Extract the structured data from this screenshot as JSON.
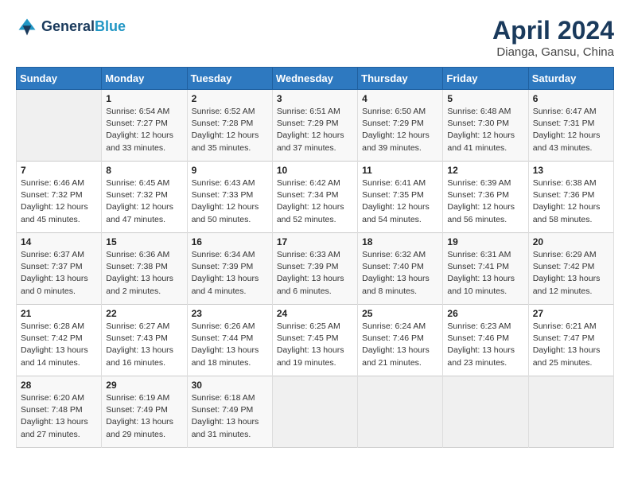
{
  "header": {
    "logo_line1": "General",
    "logo_line2": "Blue",
    "month": "April 2024",
    "location": "Dianga, Gansu, China"
  },
  "weekdays": [
    "Sunday",
    "Monday",
    "Tuesday",
    "Wednesday",
    "Thursday",
    "Friday",
    "Saturday"
  ],
  "weeks": [
    [
      {
        "day": null,
        "info": null
      },
      {
        "day": "1",
        "info": "Sunrise: 6:54 AM\nSunset: 7:27 PM\nDaylight: 12 hours\nand 33 minutes."
      },
      {
        "day": "2",
        "info": "Sunrise: 6:52 AM\nSunset: 7:28 PM\nDaylight: 12 hours\nand 35 minutes."
      },
      {
        "day": "3",
        "info": "Sunrise: 6:51 AM\nSunset: 7:29 PM\nDaylight: 12 hours\nand 37 minutes."
      },
      {
        "day": "4",
        "info": "Sunrise: 6:50 AM\nSunset: 7:29 PM\nDaylight: 12 hours\nand 39 minutes."
      },
      {
        "day": "5",
        "info": "Sunrise: 6:48 AM\nSunset: 7:30 PM\nDaylight: 12 hours\nand 41 minutes."
      },
      {
        "day": "6",
        "info": "Sunrise: 6:47 AM\nSunset: 7:31 PM\nDaylight: 12 hours\nand 43 minutes."
      }
    ],
    [
      {
        "day": "7",
        "info": "Sunrise: 6:46 AM\nSunset: 7:32 PM\nDaylight: 12 hours\nand 45 minutes."
      },
      {
        "day": "8",
        "info": "Sunrise: 6:45 AM\nSunset: 7:32 PM\nDaylight: 12 hours\nand 47 minutes."
      },
      {
        "day": "9",
        "info": "Sunrise: 6:43 AM\nSunset: 7:33 PM\nDaylight: 12 hours\nand 50 minutes."
      },
      {
        "day": "10",
        "info": "Sunrise: 6:42 AM\nSunset: 7:34 PM\nDaylight: 12 hours\nand 52 minutes."
      },
      {
        "day": "11",
        "info": "Sunrise: 6:41 AM\nSunset: 7:35 PM\nDaylight: 12 hours\nand 54 minutes."
      },
      {
        "day": "12",
        "info": "Sunrise: 6:39 AM\nSunset: 7:36 PM\nDaylight: 12 hours\nand 56 minutes."
      },
      {
        "day": "13",
        "info": "Sunrise: 6:38 AM\nSunset: 7:36 PM\nDaylight: 12 hours\nand 58 minutes."
      }
    ],
    [
      {
        "day": "14",
        "info": "Sunrise: 6:37 AM\nSunset: 7:37 PM\nDaylight: 13 hours\nand 0 minutes."
      },
      {
        "day": "15",
        "info": "Sunrise: 6:36 AM\nSunset: 7:38 PM\nDaylight: 13 hours\nand 2 minutes."
      },
      {
        "day": "16",
        "info": "Sunrise: 6:34 AM\nSunset: 7:39 PM\nDaylight: 13 hours\nand 4 minutes."
      },
      {
        "day": "17",
        "info": "Sunrise: 6:33 AM\nSunset: 7:39 PM\nDaylight: 13 hours\nand 6 minutes."
      },
      {
        "day": "18",
        "info": "Sunrise: 6:32 AM\nSunset: 7:40 PM\nDaylight: 13 hours\nand 8 minutes."
      },
      {
        "day": "19",
        "info": "Sunrise: 6:31 AM\nSunset: 7:41 PM\nDaylight: 13 hours\nand 10 minutes."
      },
      {
        "day": "20",
        "info": "Sunrise: 6:29 AM\nSunset: 7:42 PM\nDaylight: 13 hours\nand 12 minutes."
      }
    ],
    [
      {
        "day": "21",
        "info": "Sunrise: 6:28 AM\nSunset: 7:42 PM\nDaylight: 13 hours\nand 14 minutes."
      },
      {
        "day": "22",
        "info": "Sunrise: 6:27 AM\nSunset: 7:43 PM\nDaylight: 13 hours\nand 16 minutes."
      },
      {
        "day": "23",
        "info": "Sunrise: 6:26 AM\nSunset: 7:44 PM\nDaylight: 13 hours\nand 18 minutes."
      },
      {
        "day": "24",
        "info": "Sunrise: 6:25 AM\nSunset: 7:45 PM\nDaylight: 13 hours\nand 19 minutes."
      },
      {
        "day": "25",
        "info": "Sunrise: 6:24 AM\nSunset: 7:46 PM\nDaylight: 13 hours\nand 21 minutes."
      },
      {
        "day": "26",
        "info": "Sunrise: 6:23 AM\nSunset: 7:46 PM\nDaylight: 13 hours\nand 23 minutes."
      },
      {
        "day": "27",
        "info": "Sunrise: 6:21 AM\nSunset: 7:47 PM\nDaylight: 13 hours\nand 25 minutes."
      }
    ],
    [
      {
        "day": "28",
        "info": "Sunrise: 6:20 AM\nSunset: 7:48 PM\nDaylight: 13 hours\nand 27 minutes."
      },
      {
        "day": "29",
        "info": "Sunrise: 6:19 AM\nSunset: 7:49 PM\nDaylight: 13 hours\nand 29 minutes."
      },
      {
        "day": "30",
        "info": "Sunrise: 6:18 AM\nSunset: 7:49 PM\nDaylight: 13 hours\nand 31 minutes."
      },
      {
        "day": null,
        "info": null
      },
      {
        "day": null,
        "info": null
      },
      {
        "day": null,
        "info": null
      },
      {
        "day": null,
        "info": null
      }
    ]
  ]
}
